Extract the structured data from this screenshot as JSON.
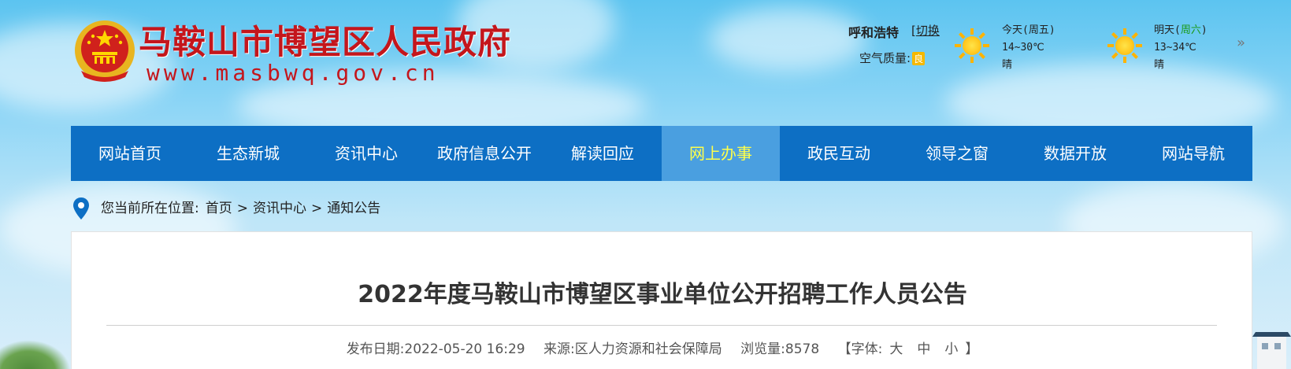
{
  "site": {
    "title": "马鞍山市博望区人民政府",
    "url": "www.masbwq.gov.cn"
  },
  "weather": {
    "city": "呼和浩特",
    "switch_label": "切换",
    "air_quality_label": "空气质量:",
    "air_quality_value": "良",
    "today": {
      "label": "今天",
      "weekday": "(周五)",
      "temp": "14~30℃",
      "condition": "晴",
      "icon": "sun-icon"
    },
    "tomorrow": {
      "label": "明天",
      "weekday_open": "(",
      "weekday": "周六",
      "weekday_close": ")",
      "temp": "13~34℃",
      "condition": "晴",
      "icon": "sun-icon"
    },
    "more_icon": "double-chevron-right-icon"
  },
  "nav": {
    "items": [
      "网站首页",
      "生态新城",
      "资讯中心",
      "政府信息公开",
      "解读回应",
      "网上办事",
      "政民互动",
      "领导之窗",
      "数据开放",
      "网站导航"
    ],
    "active": "网上办事"
  },
  "breadcrumb": {
    "icon": "location-pin-icon",
    "prefix": "您当前所在位置:",
    "items": [
      "首页",
      "资讯中心",
      "通知公告"
    ],
    "separator": ">"
  },
  "article": {
    "title": "2022年度马鞍山市博望区事业单位公开招聘工作人员公告",
    "publish_label": "发布日期:",
    "publish_date": "2022-05-20 16:29",
    "source_label": "来源:",
    "source": "区人力资源和社会保障局",
    "views_label": "浏览量:",
    "views": "8578",
    "font_label_open": "【字体:",
    "font_large": "大",
    "font_medium": "中",
    "font_small": "小",
    "font_label_close": "】"
  },
  "colors": {
    "brand_red": "#c4161c",
    "nav_blue": "#0d6fc4",
    "nav_active_bg": "#4a9fe0",
    "nav_active_text": "#ffff4a"
  }
}
